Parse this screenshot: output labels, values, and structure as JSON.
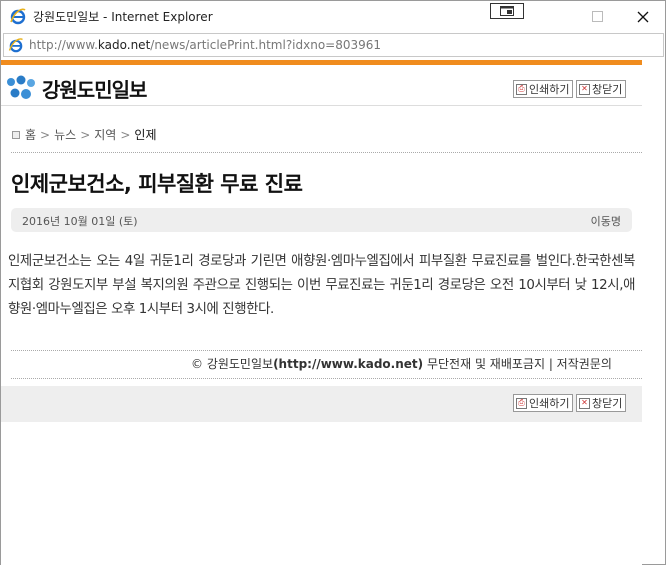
{
  "window": {
    "title": "강원도민일보 - Internet Explorer",
    "url_prefix": "http://www.",
    "url_domain": "kado.net",
    "url_path": "/news/articlePrint.html?idxno=803961"
  },
  "header": {
    "logo_text": "강원도민일보",
    "print_label": "인쇄하기",
    "close_label": "창닫기"
  },
  "breadcrumb": {
    "items": [
      "홈",
      "뉴스",
      "지역",
      "인제"
    ],
    "separator": ">"
  },
  "article": {
    "title": "인제군보건소, 피부질환 무료 진료",
    "date": "2016년 10월 01일 (토)",
    "author": "이동명",
    "body": "인제군보건소는 오는 4일 귀둔1리 경로당과 기린면 애향원·엠마누엘집에서 피부질환 무료진료를 벌인다.한국한센복지협회 강원도지부 부설 복지의원 주관으로 진행되는 이번 무료진료는 귀둔1리 경로당은 오전 10시부터 낮 12시,애향원·엠마누엘집은 오후 1시부터 3시에 진행한다."
  },
  "footer": {
    "copyright_prefix": "© 강원도민일보",
    "copyright_url": "(http://www.kado.net)",
    "copyright_suffix": "무단전재 및 재배포금지 | 저작권문의",
    "print_label": "인쇄하기",
    "close_label": "창닫기"
  },
  "colors": {
    "accent_bar": "#f08c1e",
    "ie_blue": "#1e6fd0",
    "logo_blue": "#3b8fd6"
  },
  "icons": {
    "browser": "ie-icon",
    "print": "printer-icon",
    "close": "close-x-icon",
    "breadcrumb": "square-bullet-icon"
  }
}
